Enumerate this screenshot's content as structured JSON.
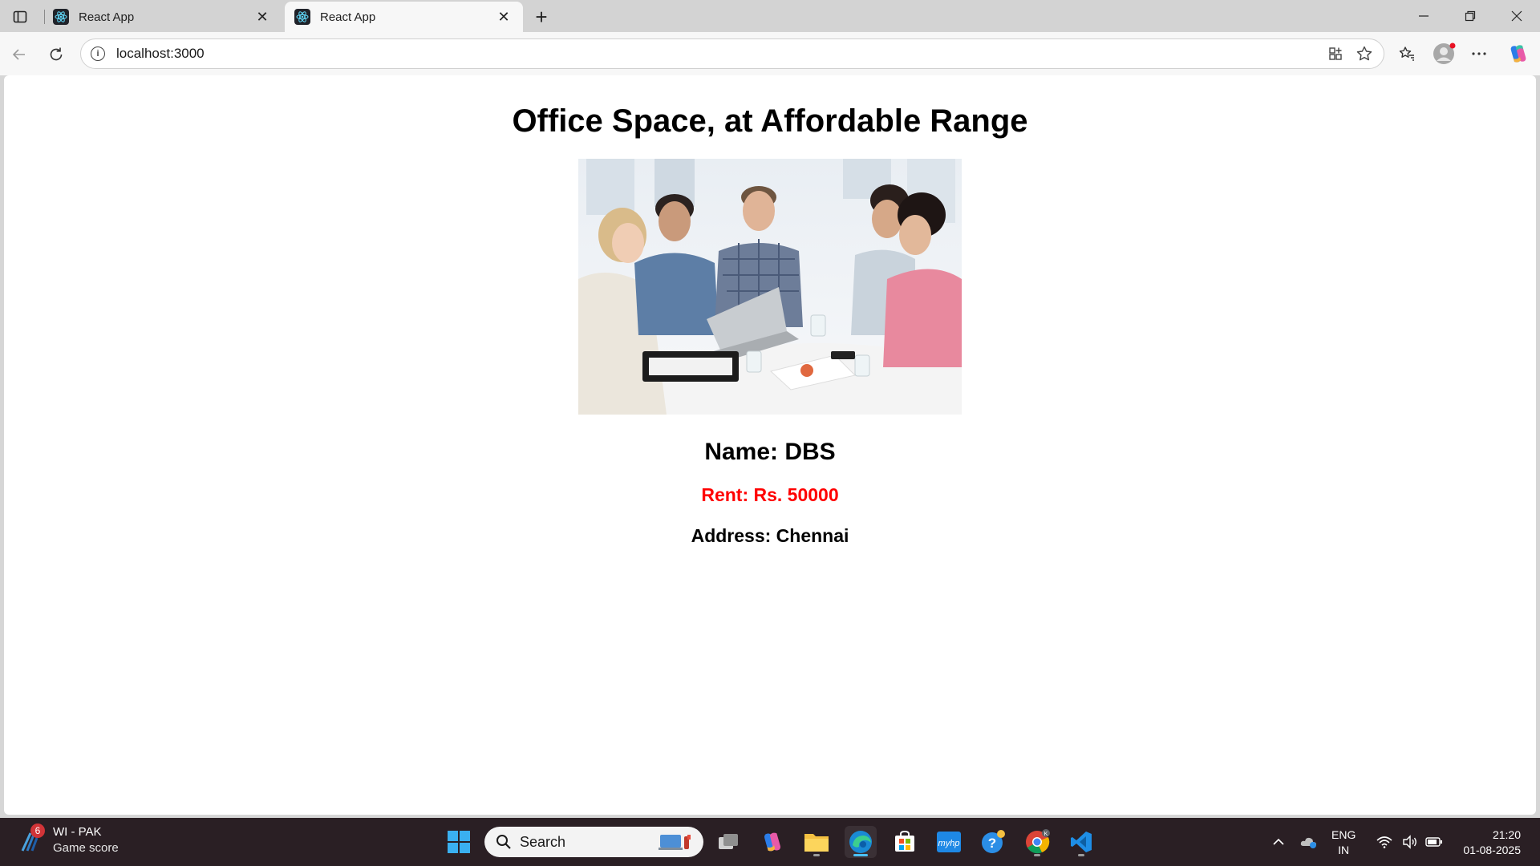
{
  "browser": {
    "tabs": [
      {
        "label": "React App",
        "active": false
      },
      {
        "label": "React App",
        "active": true
      }
    ],
    "url": "localhost:3000"
  },
  "page": {
    "heading": "Office Space, at Affordable Range",
    "image_alt": "office-meeting-photo",
    "name": "Name: DBS",
    "rent": "Rent: Rs. 50000",
    "rent_color": "#ff0000",
    "address": "Address: Chennai"
  },
  "taskbar": {
    "weather": {
      "badge": "6",
      "title": "WI - PAK",
      "subtitle": "Game score"
    },
    "search_label": "Search",
    "lang_line1": "ENG",
    "lang_line2": "IN",
    "time": "21:20",
    "date": "01-08-2025"
  }
}
